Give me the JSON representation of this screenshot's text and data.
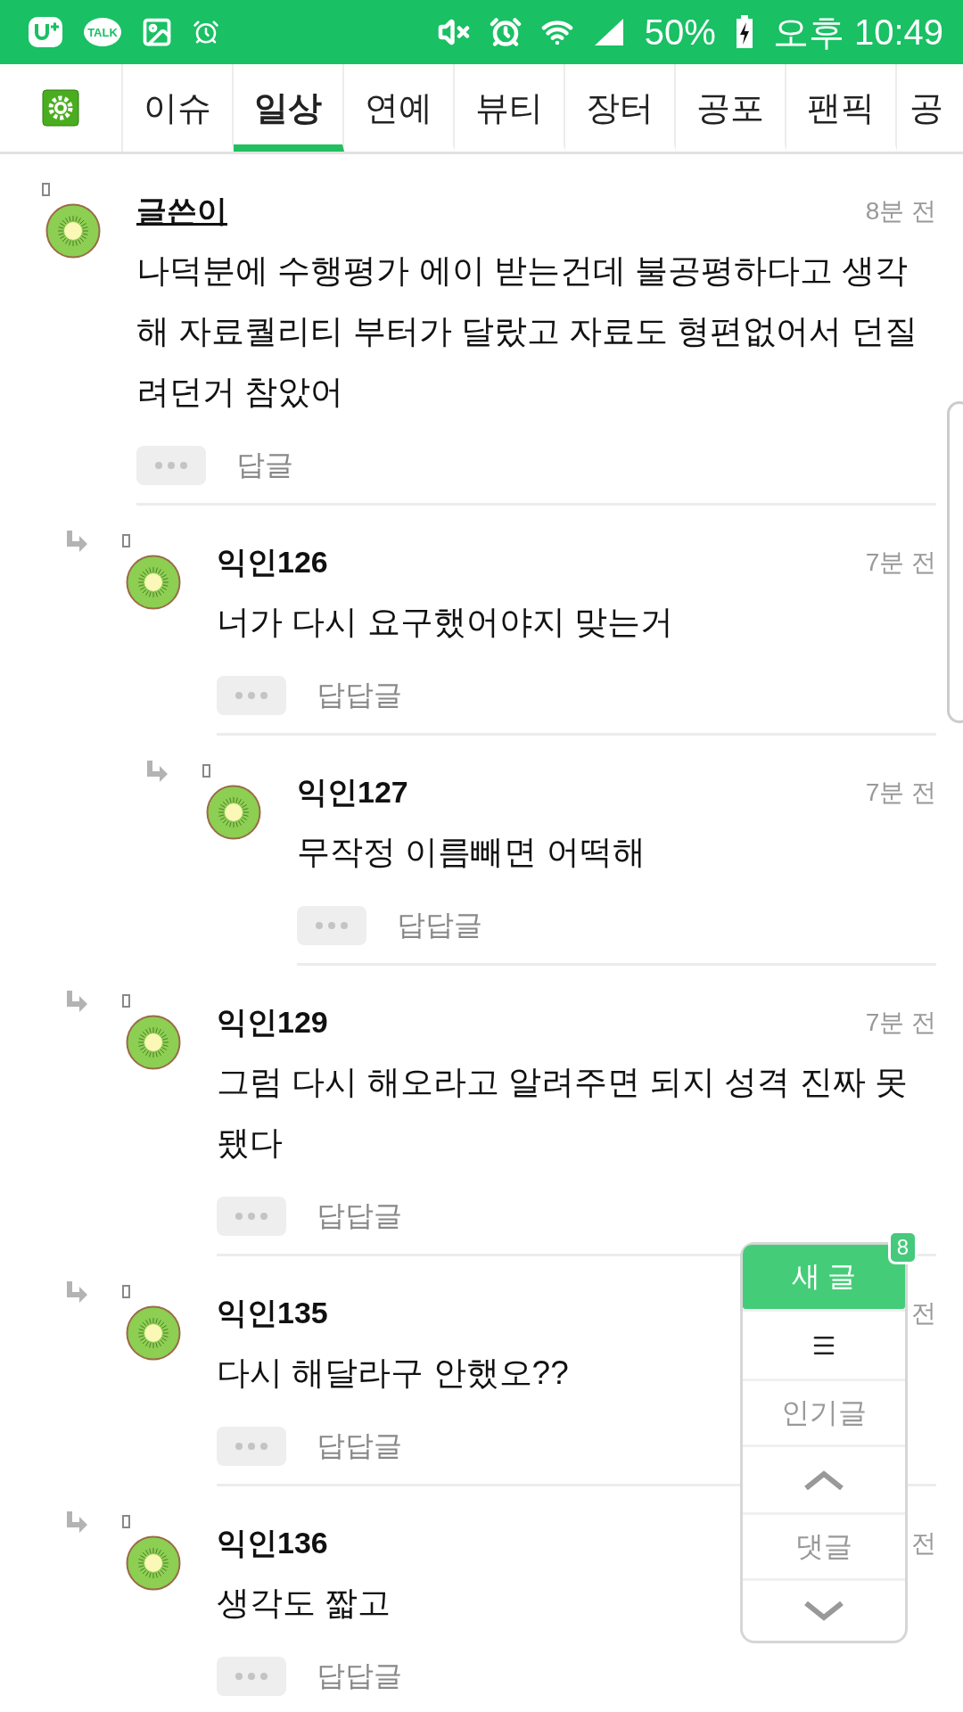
{
  "status_bar": {
    "talk_label": "TALK",
    "battery": "50%",
    "time": "오후 10:49"
  },
  "tabs": [
    {
      "label": "이슈",
      "selected": false
    },
    {
      "label": "일상",
      "selected": true
    },
    {
      "label": "연예",
      "selected": false
    },
    {
      "label": "뷰티",
      "selected": false
    },
    {
      "label": "장터",
      "selected": false
    },
    {
      "label": "공포",
      "selected": false
    },
    {
      "label": "팬픽",
      "selected": false
    },
    {
      "label": "공",
      "selected": false
    }
  ],
  "comments": [
    {
      "author": "글쓴이",
      "is_writer": true,
      "time": "8분 전",
      "text": "나덕분에 수행평가 에이 받는건데 불공평하다고 생각해 자료퀄리티 부터가 달랐고 자료도 형편없어서 던질려던거 참았어",
      "reply_label": "답글",
      "children": [
        {
          "author": "익인126",
          "is_writer": false,
          "time": "7분 전",
          "text": "너가 다시 요구했어야지 맞는거",
          "reply_label": "답답글",
          "children": [
            {
              "author": "익인127",
              "is_writer": false,
              "time": "7분 전",
              "text": "무작정 이름빼면 어떡해",
              "reply_label": "답답글"
            }
          ]
        },
        {
          "author": "익인129",
          "is_writer": false,
          "time": "7분 전",
          "text": "그럼 다시 해오라고 알려주면 되지 성격 진짜 못됐다",
          "reply_label": "답답글"
        },
        {
          "author": "익인135",
          "is_writer": false,
          "time": "전",
          "text": "다시 해달라구 안했오??",
          "reply_label": "답답글"
        },
        {
          "author": "익인136",
          "is_writer": false,
          "time": "전",
          "text": "생각도 짧고",
          "reply_label": "답답글"
        }
      ]
    }
  ],
  "floating_menu": {
    "new_post": "새 글",
    "new_count": "8",
    "popular": "인기글",
    "comments": "댓글"
  }
}
